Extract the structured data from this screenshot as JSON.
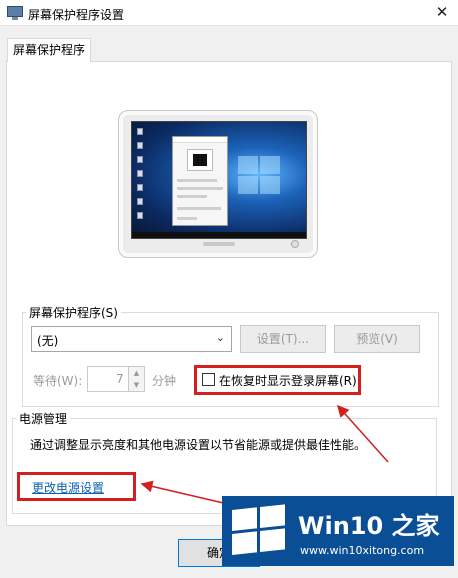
{
  "window": {
    "title": "屏幕保护程序设置",
    "close_glyph": "✕"
  },
  "tabs": [
    {
      "label": "屏幕保护程序",
      "selected": true
    }
  ],
  "screensaver": {
    "group_label": "屏幕保护程序(S)",
    "selected": "(无)",
    "settings_button": "设置(T)...",
    "preview_button": "预览(V)",
    "wait_label": "等待(W):",
    "wait_value": "7",
    "minutes_label": "分钟",
    "resume_checkbox_label": "在恢复时显示登录屏幕(R)",
    "resume_checked": false
  },
  "power": {
    "group_label": "电源管理",
    "description": "通过调整显示亮度和其他电源设置以节省能源或提供最佳性能。",
    "link": "更改电源设置"
  },
  "footer": {
    "ok_button": "确定"
  },
  "watermark": {
    "brand": "Win10 之家",
    "url": "www.win10xitong.com"
  },
  "colors": {
    "highlight": "#d21f1f",
    "link": "#0b61b4",
    "watermark_bg": "#0a4f96"
  }
}
